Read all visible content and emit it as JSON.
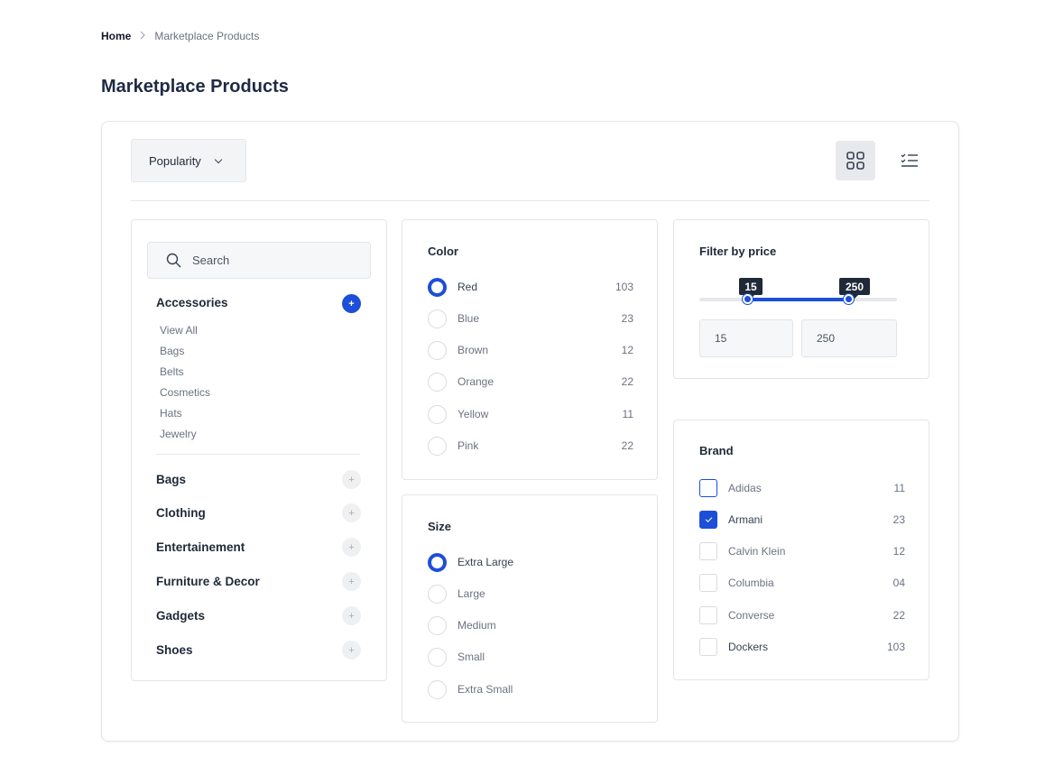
{
  "breadcrumb": {
    "home": "Home",
    "separator": ">",
    "current": "Marketplace Products"
  },
  "page_title": "Marketplace Products",
  "toolbar": {
    "sort_label": "Popularity"
  },
  "categories": {
    "search_placeholder": "Search",
    "expanded": {
      "label": "Accessories",
      "items": [
        "View All",
        "Bags",
        "Belts",
        "Cosmetics",
        "Hats",
        "Jewelry"
      ]
    },
    "collapsed": [
      "Bags",
      "Clothing",
      "Entertainement",
      "Furniture & Decor",
      "Gadgets",
      "Shoes"
    ]
  },
  "color": {
    "title": "Color",
    "options": [
      {
        "label": "Red",
        "count": "103",
        "checked": true
      },
      {
        "label": "Blue",
        "count": "23",
        "checked": false
      },
      {
        "label": "Brown",
        "count": "12",
        "checked": false
      },
      {
        "label": "Orange",
        "count": "22",
        "checked": false
      },
      {
        "label": "Yellow",
        "count": "11",
        "checked": false
      },
      {
        "label": "Pink",
        "count": "22",
        "checked": false
      }
    ]
  },
  "size": {
    "title": "Size",
    "options": [
      {
        "label": "Extra Large",
        "checked": true
      },
      {
        "label": "Large",
        "checked": false
      },
      {
        "label": "Medium",
        "checked": false
      },
      {
        "label": "Small",
        "checked": false
      },
      {
        "label": "Extra Small",
        "checked": false
      }
    ]
  },
  "price": {
    "title": "Filter by price",
    "min": "15",
    "max": "250",
    "min_input": "15",
    "max_input": "250"
  },
  "brand": {
    "title": "Brand",
    "options": [
      {
        "label": "Adidas",
        "count": "11",
        "checked": false
      },
      {
        "label": "Armani",
        "count": "23",
        "checked": true
      },
      {
        "label": "Calvin Klein",
        "count": "12",
        "checked": false
      },
      {
        "label": "Columbia",
        "count": "04",
        "checked": false
      },
      {
        "label": "Converse",
        "count": "22",
        "checked": false
      },
      {
        "label": "Dockers",
        "count": "103",
        "checked": false
      }
    ]
  },
  "colors": {
    "accent": "#1d4ed8",
    "border": "#e3e5ea",
    "muted_text": "#6b7280"
  },
  "icons": {
    "grid_view": "grid-icon",
    "list_view": "list-icon",
    "search": "search-icon",
    "expand": "plus-icon"
  }
}
